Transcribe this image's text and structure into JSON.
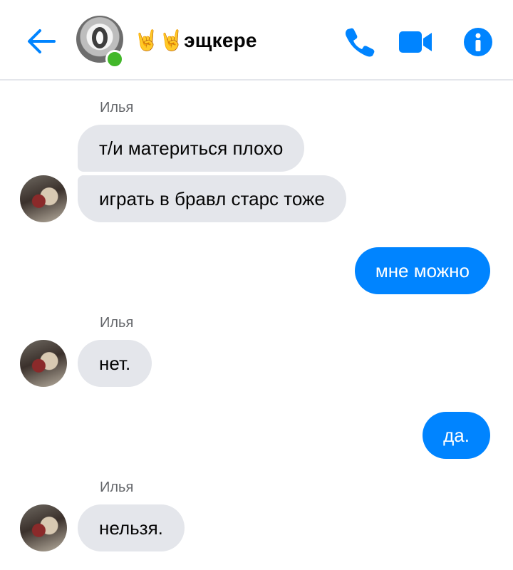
{
  "header": {
    "title": "🤘🤘эщкере",
    "back_icon": "arrow-left-icon",
    "phone_icon": "phone-icon",
    "video_icon": "video-camera-icon",
    "info_icon": "info-icon",
    "accent": "#0084ff",
    "online_color": "#42b72a"
  },
  "messages": [
    {
      "sender": "Илья",
      "direction": "incoming",
      "texts": [
        "т/и материться плохо",
        "играть в бравл старс тоже"
      ]
    },
    {
      "direction": "outgoing",
      "texts": [
        "мне можно"
      ]
    },
    {
      "sender": "Илья",
      "direction": "incoming",
      "texts": [
        "нет."
      ]
    },
    {
      "direction": "outgoing",
      "texts": [
        "да."
      ]
    },
    {
      "sender": "Илья",
      "direction": "incoming",
      "texts": [
        "нельзя."
      ]
    }
  ],
  "colors": {
    "incoming_bubble": "#e4e6eb",
    "outgoing_bubble": "#0084ff"
  }
}
